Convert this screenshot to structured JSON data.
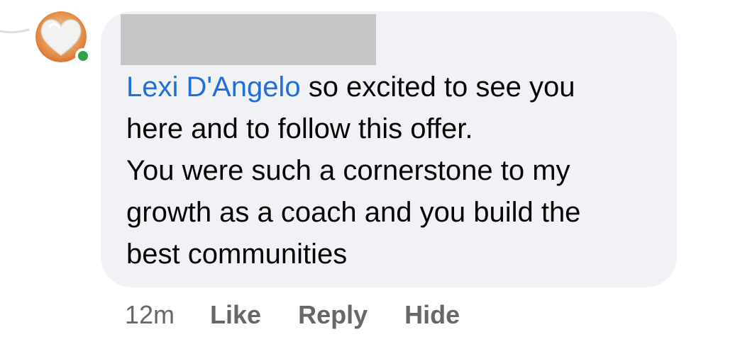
{
  "comment": {
    "avatar_icon": "heart-avatar-icon",
    "presence_status": "online",
    "author_name_redacted": true,
    "mention": "Lexi D'Angelo",
    "text_line1_rest": " so excited to see you",
    "text_rest": "here and to follow this offer.\nYou were such a cornerstone  to my\ngrowth as a coach and you build the\nbest communities",
    "timestamp": "12m",
    "actions": {
      "like": "Like",
      "reply": "Reply",
      "hide": "Hide"
    }
  },
  "colors": {
    "bubble_bg": "#f0f2f5",
    "mention": "#216fdb",
    "text": "#050505",
    "meta": "#65676b",
    "presence": "#31a24c",
    "redaction": "#c6c6c6"
  }
}
